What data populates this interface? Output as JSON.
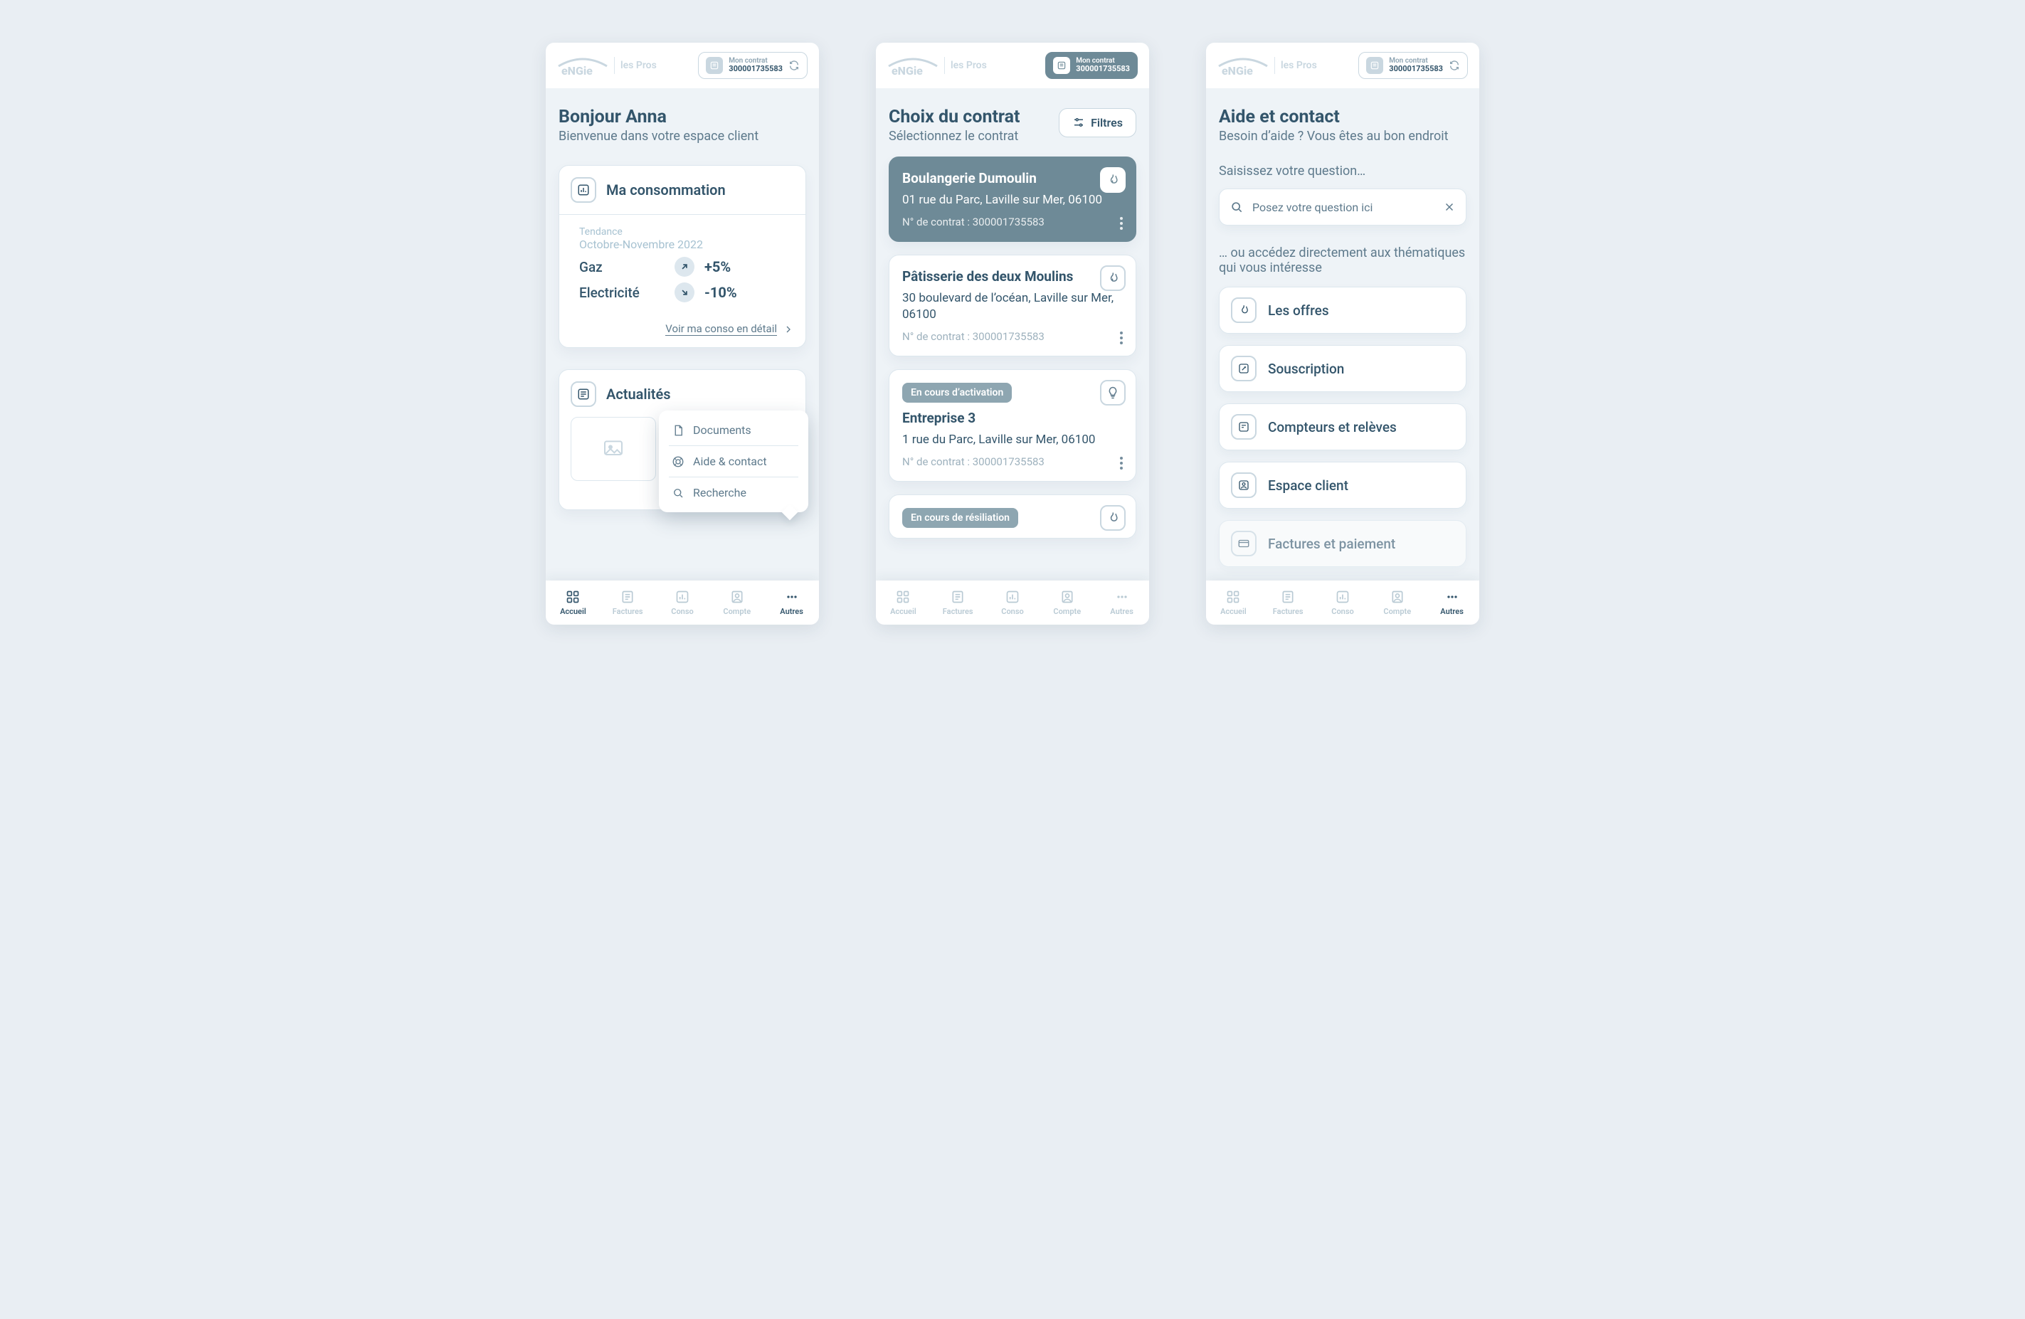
{
  "brand": {
    "word": "ENGIE",
    "suffix": "les Pros"
  },
  "contractChip": {
    "title": "Mon contrat",
    "value": "300001735583"
  },
  "nav": {
    "accueil": "Accueil",
    "factures": "Factures",
    "conso": "Conso",
    "compte": "Compte",
    "autres": "Autres"
  },
  "screen1": {
    "greeting": "Bonjour Anna",
    "welcome": "Bienvenue dans votre espace client",
    "conso": {
      "title": "Ma consommation",
      "tendanceLabel": "Tendance",
      "tendancePeriod": "Octobre-Novembre 2022",
      "rows": [
        {
          "name": "Gaz",
          "delta": "+5%",
          "dir": "up"
        },
        {
          "name": "Electricité",
          "delta": "-10%",
          "dir": "down"
        }
      ],
      "detailLink": "Voir ma conso en détail"
    },
    "news": {
      "title": "Actualités"
    },
    "popup": [
      "Documents",
      "Aide & contact",
      "Recherche"
    ]
  },
  "screen2": {
    "heading": "Choix du contrat",
    "sub": "Sélectionnez le contrat",
    "filters": "Filtres",
    "contracts": [
      {
        "name": "Boulangerie Dumoulin",
        "address": "01 rue du Parc, Laville sur Mer, 06100",
        "numberLabel": "N° de contrat :",
        "number": "300001735583",
        "selected": true,
        "icon": "flame",
        "pill": null
      },
      {
        "name": "Pâtisserie des deux Moulins",
        "address": "30 boulevard de l’océan, Laville sur Mer, 06100",
        "numberLabel": "N° de contrat :",
        "number": "300001735583",
        "selected": false,
        "icon": "flame",
        "pill": null
      },
      {
        "name": "Entreprise 3",
        "address": "1 rue du Parc, Laville sur Mer, 06100",
        "numberLabel": "N° de contrat :",
        "number": "300001735583",
        "selected": false,
        "icon": "bulb",
        "pill": "En cours d’activation"
      },
      {
        "name": "",
        "address": "",
        "numberLabel": "",
        "number": "",
        "selected": false,
        "icon": "flame",
        "pill": "En cours de résiliation"
      }
    ]
  },
  "screen3": {
    "heading": "Aide et contact",
    "sub": "Besoin d’aide ? Vous êtes au bon endroit",
    "prompt1": "Saisissez votre question…",
    "searchPlaceholder": "Posez votre question ici",
    "prompt2": "… ou accédez directement aux thématiques qui vous intéresse",
    "topics": [
      "Les offres",
      "Souscription",
      "Compteurs et relèves",
      "Espace client",
      "Factures et paiement"
    ]
  }
}
